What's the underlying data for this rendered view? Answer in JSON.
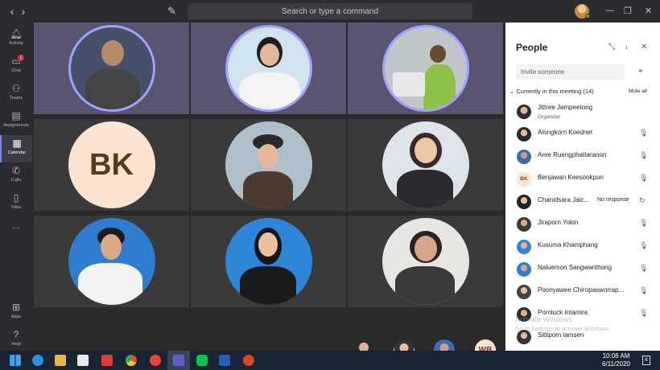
{
  "search": {
    "placeholder": "Search or type a command"
  },
  "rail": {
    "items": [
      {
        "label": "Activity",
        "icon": "bell-icon"
      },
      {
        "label": "Chat",
        "icon": "chat-icon",
        "badge": "1"
      },
      {
        "label": "Teams",
        "icon": "teams-icon"
      },
      {
        "label": "Assignments",
        "icon": "assignments-icon"
      },
      {
        "label": "Calendar",
        "icon": "calendar-icon"
      },
      {
        "label": "Calls",
        "icon": "phone-icon"
      },
      {
        "label": "Files",
        "icon": "files-icon"
      },
      {
        "label": "...",
        "icon": "more-icon"
      },
      {
        "label": "Apps",
        "icon": "apps-icon"
      },
      {
        "label": "Help",
        "icon": "help-icon"
      }
    ]
  },
  "stage": {
    "bk_initials": "BK",
    "tray_initials": "WB"
  },
  "people": {
    "title": "People",
    "invite_placeholder": "Invite someone",
    "section_label": "Currently in this meeting (14)",
    "mute_all": "Mute all",
    "no_response": "No response",
    "members": [
      {
        "name": "Jittree Jampeetong",
        "role": "Organizer"
      },
      {
        "name": "Alongkorn Koednet"
      },
      {
        "name": "Aree Ruengphattaranon"
      },
      {
        "name": "Benjawan Keesookpun",
        "initials": "BK"
      },
      {
        "name": "Chanidsara Jaic..."
      },
      {
        "name": "Jiraporn Yokin"
      },
      {
        "name": "Kusuma Khamphang"
      },
      {
        "name": "Naluemon Sangwanthong"
      },
      {
        "name": "Poonyawee Chiropasworrap..."
      },
      {
        "name": "Pornluck Intamira"
      },
      {
        "name": "Sittiporn lamsen"
      }
    ]
  },
  "watermark": {
    "line1": "Activate Windows",
    "line2": "Go to Settings to activate Windows."
  },
  "taskbar": {
    "time": "10:08 AM",
    "date": "6/11/2020",
    "notif_count": "6"
  },
  "colors": {
    "accent": "#7f85f5",
    "ring": "#9ea2ff",
    "rail_bg": "#2b2b30",
    "stage_bg": "#2a2a2a"
  }
}
